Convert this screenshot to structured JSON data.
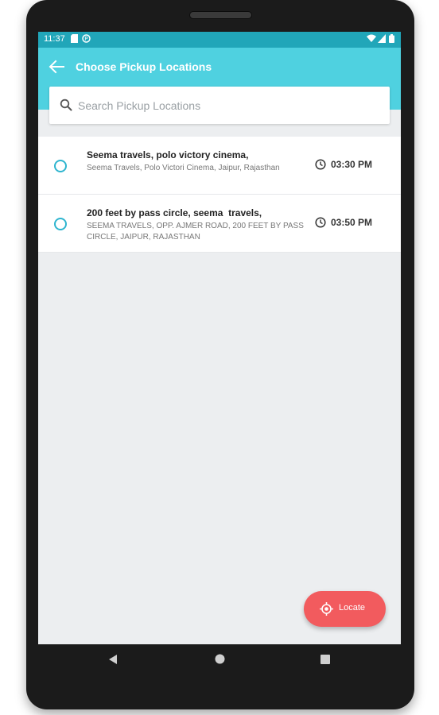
{
  "status_bar": {
    "time": "11:37"
  },
  "app_bar": {
    "title": "Choose Pickup Locations",
    "back_icon": "arrow-left-icon"
  },
  "search": {
    "placeholder": "Search Pickup Locations",
    "value": "",
    "icon": "search-icon"
  },
  "locations": [
    {
      "title": "Seema travels, polo victory cinema,",
      "subtitle": "Seema Travels, Polo Victori Cinema, Jaipur, Rajasthan",
      "time": "03:30 PM",
      "selected": false
    },
    {
      "title": "200 feet by pass circle, seema  travels,",
      "subtitle": "SEEMA TRAVELS, OPP. AJMER ROAD, 200 FEET BY PASS CIRCLE, JAIPUR, RAJASTHAN",
      "time": "03:50 PM",
      "selected": false
    }
  ],
  "fab": {
    "label": "Locate",
    "icon": "crosshair-icon"
  },
  "colors": {
    "status_bar": "#21a6b9",
    "app_bar": "#4fd1e0",
    "accent": "#2fb5cf",
    "fab": "#f25b5e",
    "screen_bg": "#eceef0"
  }
}
